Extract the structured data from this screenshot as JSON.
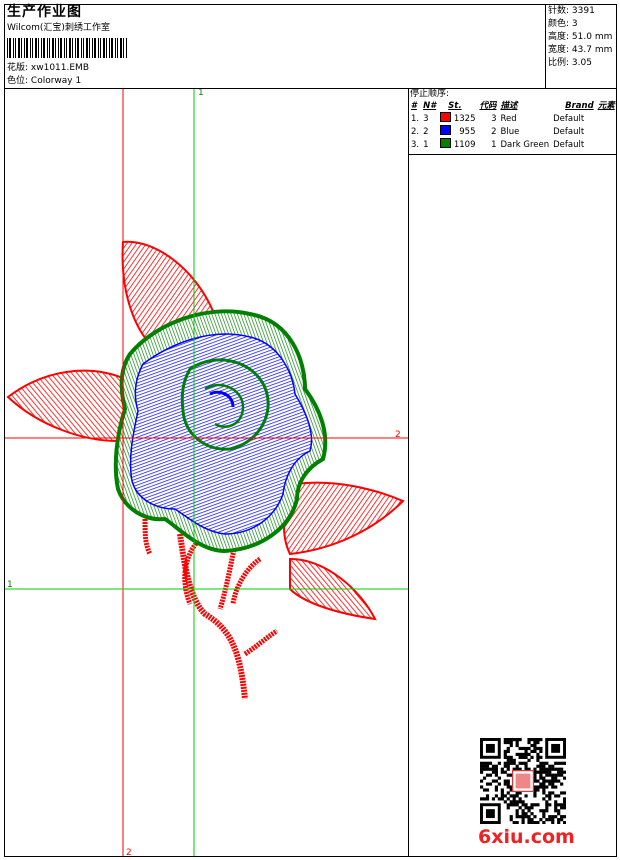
{
  "header": {
    "title": "生产作业图",
    "company": "Wilcom(汇宝)刺绣工作室",
    "design_label": "花版:",
    "design_value": "xw1011.EMB",
    "colorway_label": "色位:",
    "colorway_value": "Colorway 1"
  },
  "stats": [
    {
      "label": "针数:",
      "value": "3391"
    },
    {
      "label": "颜色:",
      "value": "3"
    },
    {
      "label": "高度:",
      "value": "51.0 mm"
    },
    {
      "label": "宽度:",
      "value": "43.7 mm"
    },
    {
      "label": "比例:",
      "value": "3.05"
    }
  ],
  "stop_sequence": {
    "title": "停止顺序:",
    "headers": [
      "#",
      "N#",
      "St.",
      "代码",
      "描述",
      "Brand",
      "元素"
    ],
    "rows": [
      {
        "idx": "1.",
        "n": "3",
        "color": "#ff0000",
        "st": "1325",
        "code": "3",
        "desc": "Red",
        "brand": "Default"
      },
      {
        "idx": "2.",
        "n": "2",
        "color": "#0000ff",
        "st": "955",
        "code": "2",
        "desc": "Blue",
        "brand": "Default"
      },
      {
        "idx": "3.",
        "n": "1",
        "color": "#008000",
        "st": "1109",
        "code": "1",
        "desc": "Dark Green",
        "brand": "Default"
      }
    ]
  },
  "guides": {
    "green_vertical_label": "1",
    "red_horizontal_label": "2",
    "green_horizontal_label": "1",
    "red_vertical_label": "2"
  },
  "colors": {
    "red": "#ff0000",
    "blue": "#0000ff",
    "green": "#008000",
    "brand": "#ee2222"
  },
  "watermark": {
    "text": "6xiu.com",
    "seal_text": "印章"
  }
}
